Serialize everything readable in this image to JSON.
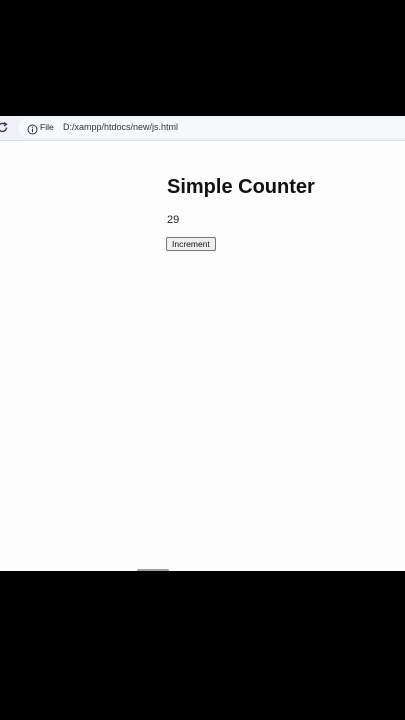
{
  "browser": {
    "address_bar": {
      "security_chip_label": "File",
      "url": "D:/xampp/htdocs/new/js.html"
    }
  },
  "page": {
    "title": "Simple Counter",
    "counter_value": "29",
    "increment_button_label": "Increment"
  },
  "icons": {
    "reload": "reload-icon",
    "info": "info-icon"
  },
  "colors": {
    "toolbar_bg": "#eef2f8",
    "page_bg": "#fdfdfe",
    "letterbox": "#000000"
  }
}
